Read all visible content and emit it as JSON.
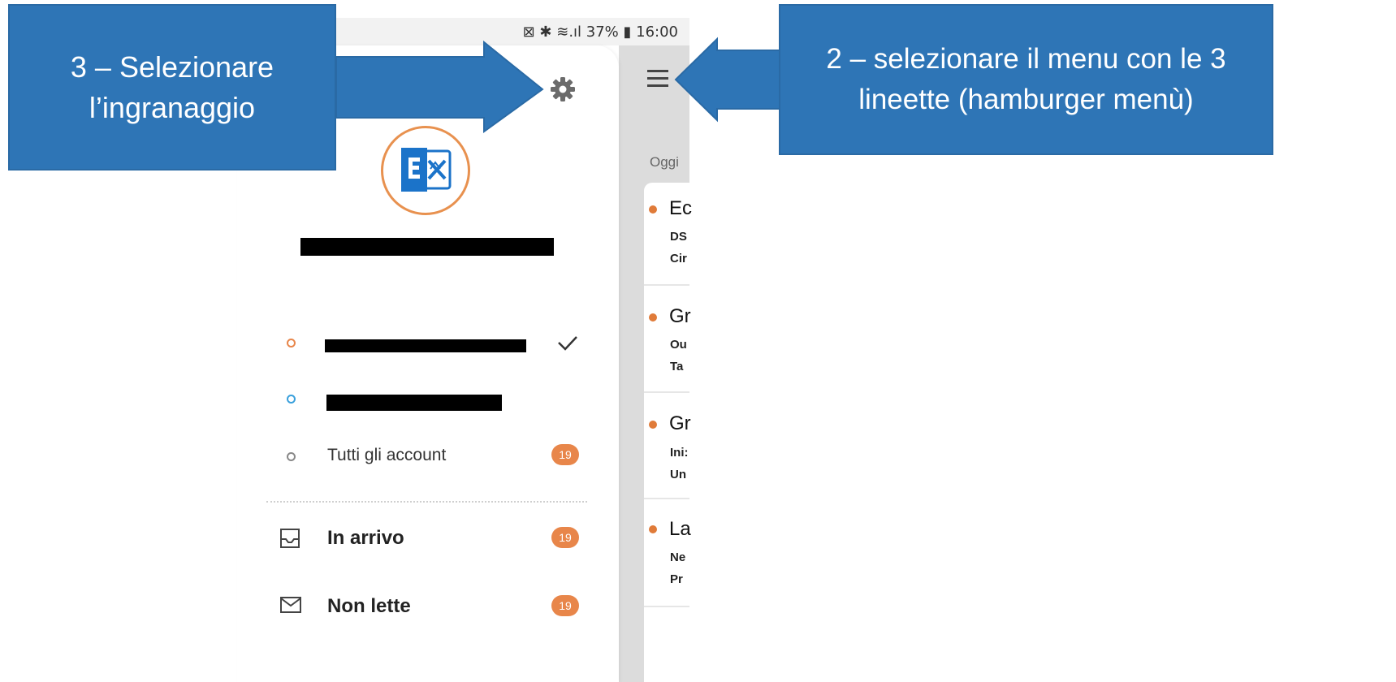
{
  "status_bar": {
    "text": "⊠ ✱ ≋.ıl 37% ▮ 16:00",
    "battery": "37%",
    "time": "16:00"
  },
  "maillist": {
    "section_label": "Oggi",
    "items": [
      {
        "title": "Ec",
        "line1": "DS",
        "line2": "Cir"
      },
      {
        "title": "Gr",
        "line1": "Ou",
        "line2": "Ta"
      },
      {
        "title": "Gr",
        "line1": "Ini:",
        "line2": "Un"
      },
      {
        "title": "La",
        "line1": "Ne",
        "line2": "Pr"
      }
    ]
  },
  "drawer": {
    "accounts": [
      {
        "label": "",
        "dot_color": "#e8864a",
        "selected": true
      },
      {
        "label": "",
        "dot_color": "#3aa0dc",
        "selected": false
      },
      {
        "label": "Tutti gli account",
        "dot_color": "#888888",
        "badge": "19"
      }
    ],
    "folders": [
      {
        "label": "In arrivo",
        "icon": "inbox-icon",
        "badge": "19"
      },
      {
        "label": "Non lette",
        "icon": "envelope-icon",
        "badge": "19"
      }
    ]
  },
  "callouts": {
    "left": "3 – Selezionare l’ingranaggio",
    "right": "2 – selezionare il menu con le 3 lineette (hamburger menù)"
  },
  "colors": {
    "accent": "#e8864a",
    "callout": "#2e75b6",
    "exchange_blue": "#1b73c9"
  }
}
